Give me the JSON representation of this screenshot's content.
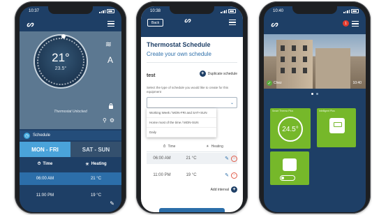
{
  "phone1": {
    "time": "10:37",
    "logo": "ᔕ",
    "current_temp": "21°",
    "set_temp": "23.5°",
    "lock_status": "Thermostat Unlocked",
    "schedule_title": "Schedule",
    "tabs": [
      "MON - FRI",
      "SAT - SUN"
    ],
    "columns": [
      "Time",
      "Heating"
    ],
    "rows": [
      {
        "time": "06:00 AM",
        "temp": "21 °C"
      },
      {
        "time": "11:00 PM",
        "temp": "19 °C"
      }
    ]
  },
  "phone2": {
    "time": "10:38",
    "back": "Back",
    "logo": "ᔕ",
    "title": "Thermostat Schedule",
    "subtitle": "Create your own schedule",
    "schedule_name": "test",
    "duplicate": "Duplicate schedule",
    "help": "Select the type of schedule you would like to create for this equipment",
    "dropdown_options": [
      "Working Week / MON-FRI and SAT+SUN",
      "Home most of the time / MON-SUN",
      "Daily"
    ],
    "columns": [
      "Time",
      "Heating"
    ],
    "rows": [
      {
        "time": "06:00 AM",
        "temp": "21 °C"
      },
      {
        "time": "11:00 PM",
        "temp": "19 °C"
      }
    ],
    "add_interval": "Add interval"
  },
  "phone3": {
    "time": "10:40",
    "logo": "ᔕ",
    "notification_count": "1",
    "photo_label": "Chez",
    "photo_time": "10:40",
    "tile_thermostat_label": "Smart Thermo Plus",
    "tile_thermostat_temp": "24.5°",
    "tile_boiler_label": "Intelligent Plus",
    "tile_plug_label": ""
  },
  "colors": {
    "navy": "#1e3f66",
    "accent_blue": "#4aa3da",
    "green": "#76b82a",
    "red": "#e05a47"
  }
}
